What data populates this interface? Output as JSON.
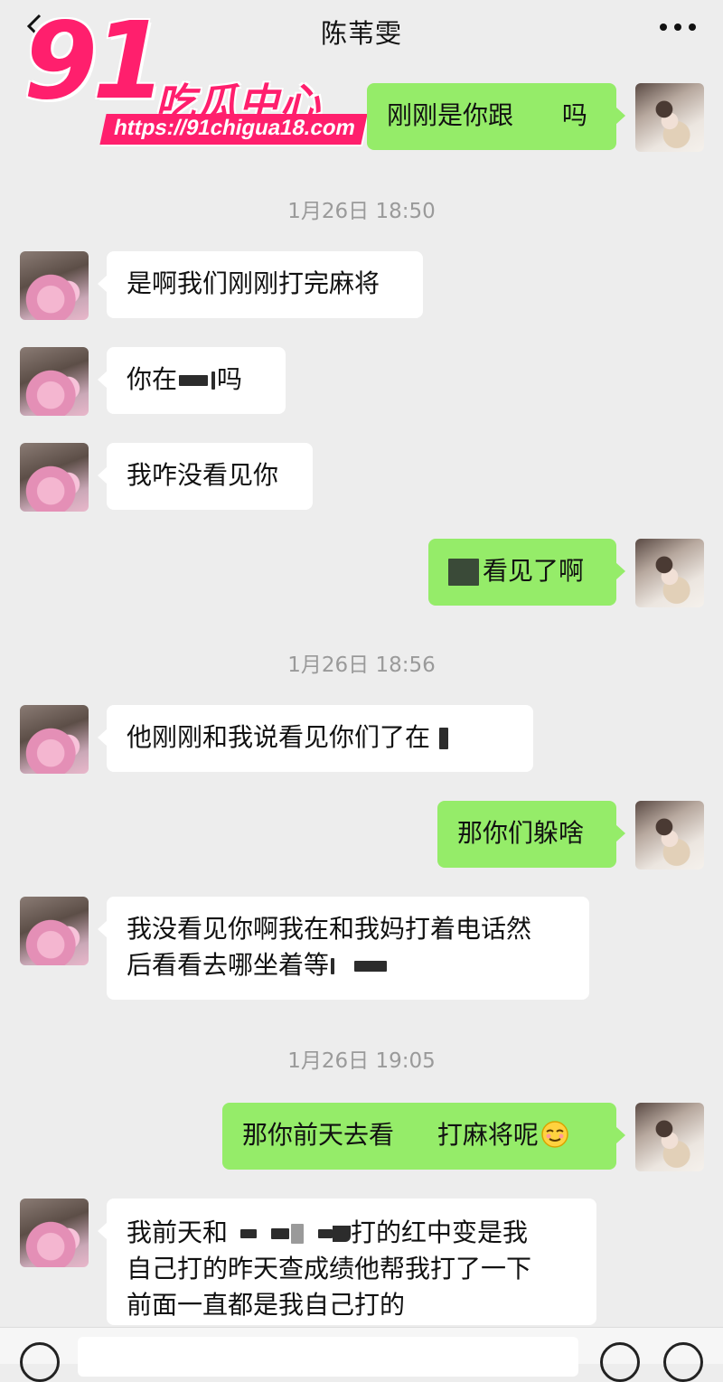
{
  "header": {
    "title": "陈苇雯",
    "back_icon": "chevron-left-icon",
    "more_icon": "more-dots-icon"
  },
  "watermark": {
    "number": "91",
    "text": "吃瓜中心",
    "url": "https://91chigua18.com",
    "color": "#ff1f6d"
  },
  "colors": {
    "background": "#ededed",
    "bubble_me": "#95ec69",
    "bubble_other": "#ffffff",
    "timestamp": "#9a9a9a"
  },
  "messages": [
    {
      "from": "me",
      "parts": [
        "刚刚是你跟",
        "吗"
      ]
    },
    {
      "timestamp": "1月26日 18:50"
    },
    {
      "from": "other",
      "parts": [
        "是啊我们刚刚打完麻将"
      ]
    },
    {
      "from": "other",
      "parts": [
        "你在",
        "吗"
      ]
    },
    {
      "from": "other",
      "parts": [
        "我咋没看见你"
      ]
    },
    {
      "from": "me",
      "parts": [
        "看见了啊"
      ]
    },
    {
      "timestamp": "1月26日 18:56"
    },
    {
      "from": "other",
      "parts": [
        "他刚刚和我说看见你们了在"
      ]
    },
    {
      "from": "me",
      "parts": [
        "那你们躲啥"
      ]
    },
    {
      "from": "other",
      "parts": [
        "我没看见你啊我在和我妈打着电话然",
        "后看看去哪坐着等"
      ]
    },
    {
      "timestamp": "1月26日 19:05"
    },
    {
      "from": "me",
      "parts": [
        "那你前天去看",
        "打麻将呢"
      ],
      "emoji": "squinting-face-emoji"
    },
    {
      "from": "other",
      "parts": [
        "我前天和",
        "打的红中变是我",
        "自己打的昨天查成绩他帮我打了一下",
        "前面一直都是我自己打的"
      ]
    }
  ]
}
